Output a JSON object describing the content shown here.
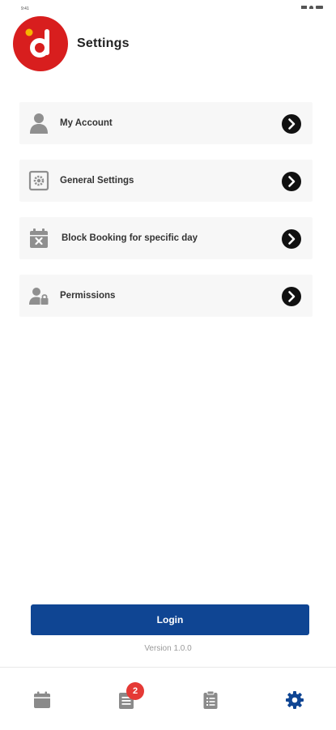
{
  "status_bar": {
    "time": "9:41"
  },
  "header": {
    "title": "Settings",
    "logo_letter": "d",
    "logo_color": "#d81e1e",
    "logo_dot_color": "#f7b500"
  },
  "menu": {
    "items": [
      {
        "label": "My Account",
        "icon": "person-icon"
      },
      {
        "label": "General Settings",
        "icon": "gear-square-icon"
      },
      {
        "label": "Block Booking for specific day",
        "icon": "calendar-x-icon"
      },
      {
        "label": "Permissions",
        "icon": "user-lock-icon"
      }
    ],
    "arrow_icon": "chevron-right-circle-icon"
  },
  "login": {
    "label": "Login",
    "color": "#0f4593"
  },
  "version": "Version 1.0.0",
  "tabbar": {
    "tabs": [
      {
        "name": "calendar",
        "icon": "calendar-icon",
        "active": false
      },
      {
        "name": "bookings",
        "icon": "list-icon",
        "active": false,
        "badge": "2"
      },
      {
        "name": "tasks",
        "icon": "clipboard-icon",
        "active": false
      },
      {
        "name": "settings",
        "icon": "gear-icon",
        "active": true
      }
    ],
    "active_color": "#0f4593",
    "inactive_color": "#8a8a8a",
    "badge_color": "#e53935"
  }
}
